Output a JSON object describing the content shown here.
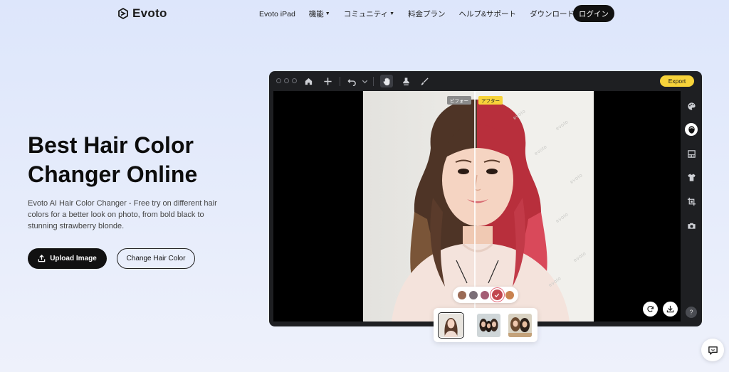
{
  "header": {
    "brand": "Evoto",
    "nav": [
      {
        "label": "Evoto iPad",
        "dropdown": false
      },
      {
        "label": "機能",
        "dropdown": true
      },
      {
        "label": "コミュニティ",
        "dropdown": true
      },
      {
        "label": "料金プラン",
        "dropdown": false
      },
      {
        "label": "ヘルプ&サポート",
        "dropdown": false
      },
      {
        "label": "ダウンロード",
        "dropdown": false
      }
    ],
    "login_label": "ログイン",
    "caret": "▼"
  },
  "hero": {
    "title": "Best Hair Color Changer Online",
    "description": "Evoto AI Hair Color Changer - Free try on different hair colors for a better look on photo, from bold black to stunning strawberry blonde.",
    "upload_label": "Upload Image",
    "change_label": "Change Hair Color"
  },
  "editor": {
    "export_label": "Export",
    "before_label": "ビフォー",
    "after_label": "アフター",
    "watermark": "evoto",
    "help_label": "?",
    "toolbar_icons": [
      "home-icon",
      "plus-icon",
      "undo-icon",
      "chevron-down-icon",
      "hand-icon",
      "stamp-icon",
      "brush-icon"
    ],
    "side_icons": [
      "palette-icon",
      "face-icon",
      "texture-icon",
      "shirt-icon",
      "crop-icon",
      "camera-icon"
    ],
    "active_side_icon": "face-icon"
  },
  "swatches": [
    {
      "color": "#9a6a55"
    },
    {
      "color": "#7b6f78"
    },
    {
      "color": "#a45d74"
    },
    {
      "color": "#c2464f",
      "selected": true
    },
    {
      "color": "#c9824f"
    }
  ],
  "thumbnails": [
    {
      "selected": true
    },
    {
      "selected": false
    },
    {
      "selected": false
    }
  ],
  "colors": {
    "accent_yellow": "#f7d33a",
    "dark": "#111111",
    "window": "#1e1f22"
  }
}
